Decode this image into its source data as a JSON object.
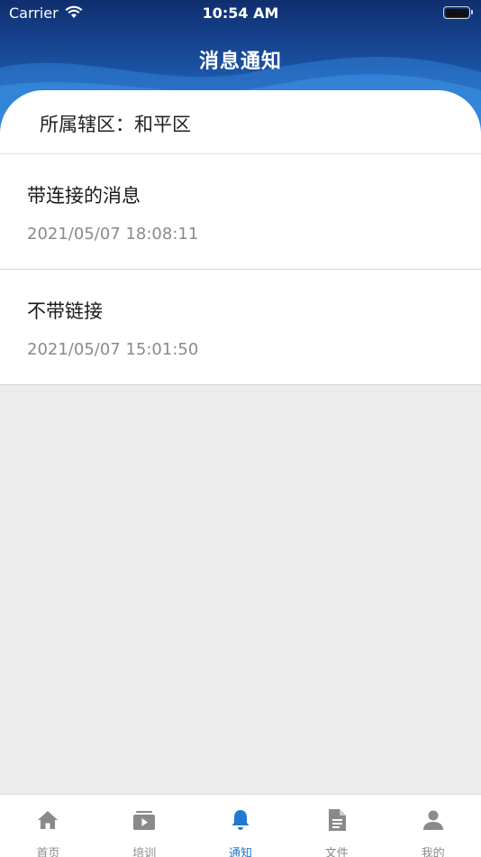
{
  "status_bar": {
    "carrier": "Carrier",
    "time": "10:54 AM"
  },
  "nav": {
    "title": "消息通知"
  },
  "district": {
    "label": "所属辖区：和平区"
  },
  "messages": [
    {
      "title": "带连接的消息",
      "time": "2021/05/07 18:08:11"
    },
    {
      "title": "不带链接",
      "time": "2021/05/07 15:01:50"
    }
  ],
  "tabbar": {
    "tabs": [
      {
        "label": "首页",
        "icon": "home-icon"
      },
      {
        "label": "培训",
        "icon": "video-icon"
      },
      {
        "label": "通知",
        "icon": "bell-icon",
        "active": true
      },
      {
        "label": "文件",
        "icon": "document-icon"
      },
      {
        "label": "我的",
        "icon": "person-icon"
      }
    ]
  },
  "colors": {
    "header": "#1a4fa0",
    "accent": "#1f7ad0",
    "inactive": "#8a8a8a",
    "background": "#ececec"
  }
}
